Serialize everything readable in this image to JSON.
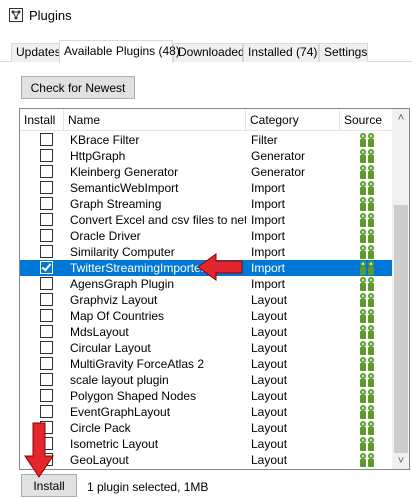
{
  "window": {
    "title": "Plugins",
    "icon": "gephi-app-icon"
  },
  "tabs": [
    {
      "label": "Updates",
      "active": false
    },
    {
      "label": "Available Plugins (48)",
      "active": true
    },
    {
      "label": "Downloaded",
      "active": false
    },
    {
      "label": "Installed (74)",
      "active": false
    },
    {
      "label": "Settings",
      "active": false
    }
  ],
  "buttons": {
    "check_newest": "Check for Newest",
    "install": "Install"
  },
  "table": {
    "columns": [
      "Install",
      "Name",
      "Category",
      "Source"
    ],
    "rows": [
      {
        "name": "KBrace Filter",
        "category": "Filter",
        "checked": false,
        "selected": false
      },
      {
        "name": "HttpGraph",
        "category": "Generator",
        "checked": false,
        "selected": false
      },
      {
        "name": "Kleinberg Generator",
        "category": "Generator",
        "checked": false,
        "selected": false
      },
      {
        "name": "SemanticWebImport",
        "category": "Import",
        "checked": false,
        "selected": false
      },
      {
        "name": "Graph Streaming",
        "category": "Import",
        "checked": false,
        "selected": false
      },
      {
        "name": "Convert Excel and csv files to net...",
        "category": "Import",
        "checked": false,
        "selected": false
      },
      {
        "name": "Oracle Driver",
        "category": "Import",
        "checked": false,
        "selected": false
      },
      {
        "name": "Similarity Computer",
        "category": "Import",
        "checked": false,
        "selected": false
      },
      {
        "name": "TwitterStreamingImporter",
        "category": "Import",
        "checked": true,
        "selected": true
      },
      {
        "name": "AgensGraph Plugin",
        "category": "Import",
        "checked": false,
        "selected": false
      },
      {
        "name": "Graphviz Layout",
        "category": "Layout",
        "checked": false,
        "selected": false
      },
      {
        "name": "Map Of Countries",
        "category": "Layout",
        "checked": false,
        "selected": false
      },
      {
        "name": "MdsLayout",
        "category": "Layout",
        "checked": false,
        "selected": false
      },
      {
        "name": "Circular Layout",
        "category": "Layout",
        "checked": false,
        "selected": false
      },
      {
        "name": "MultiGravity ForceAtlas 2",
        "category": "Layout",
        "checked": false,
        "selected": false
      },
      {
        "name": "scale layout plugin",
        "category": "Layout",
        "checked": false,
        "selected": false
      },
      {
        "name": "Polygon Shaped Nodes",
        "category": "Layout",
        "checked": false,
        "selected": false
      },
      {
        "name": "EventGraphLayout",
        "category": "Layout",
        "checked": false,
        "selected": false
      },
      {
        "name": "Circle Pack",
        "category": "Layout",
        "checked": false,
        "selected": false
      },
      {
        "name": "Isometric Layout",
        "category": "Layout",
        "checked": false,
        "selected": false
      },
      {
        "name": "GeoLayout",
        "category": "Layout",
        "checked": false,
        "selected": false
      }
    ]
  },
  "status": "1 plugin selected, 1MB",
  "colors": {
    "selection": "#0078d7",
    "annotation_arrow": "#e3262c",
    "source_icon": "#5a9a2a"
  }
}
